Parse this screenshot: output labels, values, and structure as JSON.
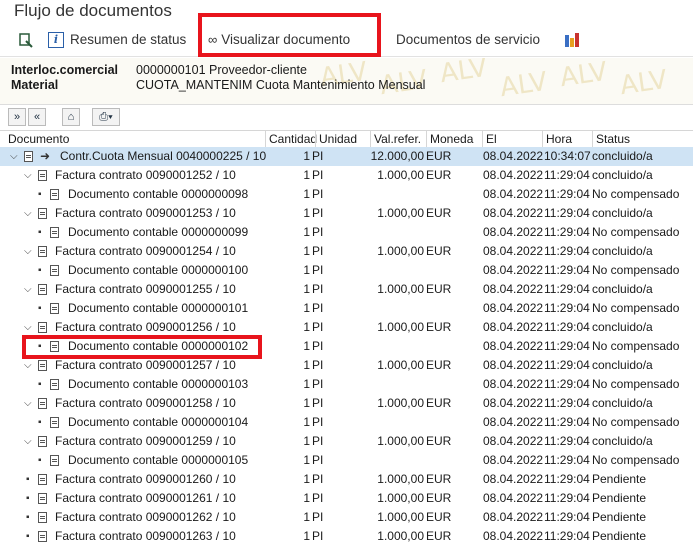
{
  "window": {
    "title": "Flujo de documentos"
  },
  "toolbar": {
    "status_summary": "Resumen de status",
    "display_document": "Visualizar documento",
    "service_documents": "Documentos de servicio"
  },
  "header": {
    "partner_label": "Interloc.comercial",
    "partner_value": "0000000101 Proveedor-cliente",
    "material_label": "Material",
    "material_value": "CUOTA_MANTENIM Cuota Mantenimiento Mensual",
    "watermark": "ALV"
  },
  "columns": {
    "document": "Documento",
    "quantity": "Cantidad",
    "unit": "Unidad",
    "ref_value": "Val.refer.",
    "currency": "Moneda",
    "date": "El",
    "time": "Hora",
    "status": "Status"
  },
  "rows": [
    {
      "level": 0,
      "doc": "Contr.Cuota Mensual 0040000225 / 10",
      "qty": "1",
      "unit": "PI",
      "val": "12.000,00",
      "cur": "EUR",
      "date": "08.04.2022",
      "time": "10:34:07",
      "status": "concluido/a"
    },
    {
      "level": 1,
      "doc": "Factura contrato 0090001252 / 10",
      "qty": "1",
      "unit": "PI",
      "val": "1.000,00",
      "cur": "EUR",
      "date": "08.04.2022",
      "time": "11:29:04",
      "status": "concluido/a"
    },
    {
      "level": 2,
      "doc": "Documento contable 0000000098",
      "qty": "1",
      "unit": "PI",
      "val": "",
      "cur": "",
      "date": "08.04.2022",
      "time": "11:29:04",
      "status": "No compensado"
    },
    {
      "level": 1,
      "doc": "Factura contrato 0090001253 / 10",
      "qty": "1",
      "unit": "PI",
      "val": "1.000,00",
      "cur": "EUR",
      "date": "08.04.2022",
      "time": "11:29:04",
      "status": "concluido/a"
    },
    {
      "level": 2,
      "doc": "Documento contable 0000000099",
      "qty": "1",
      "unit": "PI",
      "val": "",
      "cur": "",
      "date": "08.04.2022",
      "time": "11:29:04",
      "status": "No compensado"
    },
    {
      "level": 1,
      "doc": "Factura contrato 0090001254 / 10",
      "qty": "1",
      "unit": "PI",
      "val": "1.000,00",
      "cur": "EUR",
      "date": "08.04.2022",
      "time": "11:29:04",
      "status": "concluido/a"
    },
    {
      "level": 2,
      "doc": "Documento contable 0000000100",
      "qty": "1",
      "unit": "PI",
      "val": "",
      "cur": "",
      "date": "08.04.2022",
      "time": "11:29:04",
      "status": "No compensado"
    },
    {
      "level": 1,
      "doc": "Factura contrato 0090001255 / 10",
      "qty": "1",
      "unit": "PI",
      "val": "1.000,00",
      "cur": "EUR",
      "date": "08.04.2022",
      "time": "11:29:04",
      "status": "concluido/a"
    },
    {
      "level": 2,
      "doc": "Documento contable 0000000101",
      "qty": "1",
      "unit": "PI",
      "val": "",
      "cur": "",
      "date": "08.04.2022",
      "time": "11:29:04",
      "status": "No compensado"
    },
    {
      "level": 1,
      "doc": "Factura contrato 0090001256 / 10",
      "qty": "1",
      "unit": "PI",
      "val": "1.000,00",
      "cur": "EUR",
      "date": "08.04.2022",
      "time": "11:29:04",
      "status": "concluido/a"
    },
    {
      "level": 2,
      "doc": "Documento contable 0000000102",
      "qty": "1",
      "unit": "PI",
      "val": "",
      "cur": "",
      "date": "08.04.2022",
      "time": "11:29:04",
      "status": "No compensado"
    },
    {
      "level": 1,
      "doc": "Factura contrato 0090001257 / 10",
      "qty": "1",
      "unit": "PI",
      "val": "1.000,00",
      "cur": "EUR",
      "date": "08.04.2022",
      "time": "11:29:04",
      "status": "concluido/a"
    },
    {
      "level": 2,
      "doc": "Documento contable 0000000103",
      "qty": "1",
      "unit": "PI",
      "val": "",
      "cur": "",
      "date": "08.04.2022",
      "time": "11:29:04",
      "status": "No compensado"
    },
    {
      "level": 1,
      "doc": "Factura contrato 0090001258 / 10",
      "qty": "1",
      "unit": "PI",
      "val": "1.000,00",
      "cur": "EUR",
      "date": "08.04.2022",
      "time": "11:29:04",
      "status": "concluido/a"
    },
    {
      "level": 2,
      "doc": "Documento contable 0000000104",
      "qty": "1",
      "unit": "PI",
      "val": "",
      "cur": "",
      "date": "08.04.2022",
      "time": "11:29:04",
      "status": "No compensado"
    },
    {
      "level": 1,
      "doc": "Factura contrato 0090001259 / 10",
      "qty": "1",
      "unit": "PI",
      "val": "1.000,00",
      "cur": "EUR",
      "date": "08.04.2022",
      "time": "11:29:04",
      "status": "concluido/a"
    },
    {
      "level": 2,
      "doc": "Documento contable 0000000105",
      "qty": "1",
      "unit": "PI",
      "val": "",
      "cur": "",
      "date": "08.04.2022",
      "time": "11:29:04",
      "status": "No compensado"
    },
    {
      "level": 3,
      "doc": "Factura contrato 0090001260 / 10",
      "qty": "1",
      "unit": "PI",
      "val": "1.000,00",
      "cur": "EUR",
      "date": "08.04.2022",
      "time": "11:29:04",
      "status": "Pendiente"
    },
    {
      "level": 3,
      "doc": "Factura contrato 0090001261 / 10",
      "qty": "1",
      "unit": "PI",
      "val": "1.000,00",
      "cur": "EUR",
      "date": "08.04.2022",
      "time": "11:29:04",
      "status": "Pendiente"
    },
    {
      "level": 3,
      "doc": "Factura contrato 0090001262 / 10",
      "qty": "1",
      "unit": "PI",
      "val": "1.000,00",
      "cur": "EUR",
      "date": "08.04.2022",
      "time": "11:29:04",
      "status": "Pendiente"
    },
    {
      "level": 3,
      "doc": "Factura contrato 0090001263 / 10",
      "qty": "1",
      "unit": "PI",
      "val": "1.000,00",
      "cur": "EUR",
      "date": "08.04.2022",
      "time": "11:29:04",
      "status": "Pendiente"
    }
  ],
  "colors": {
    "highlight_box": "#e8141c",
    "selected_row": "#cfe3f4"
  }
}
